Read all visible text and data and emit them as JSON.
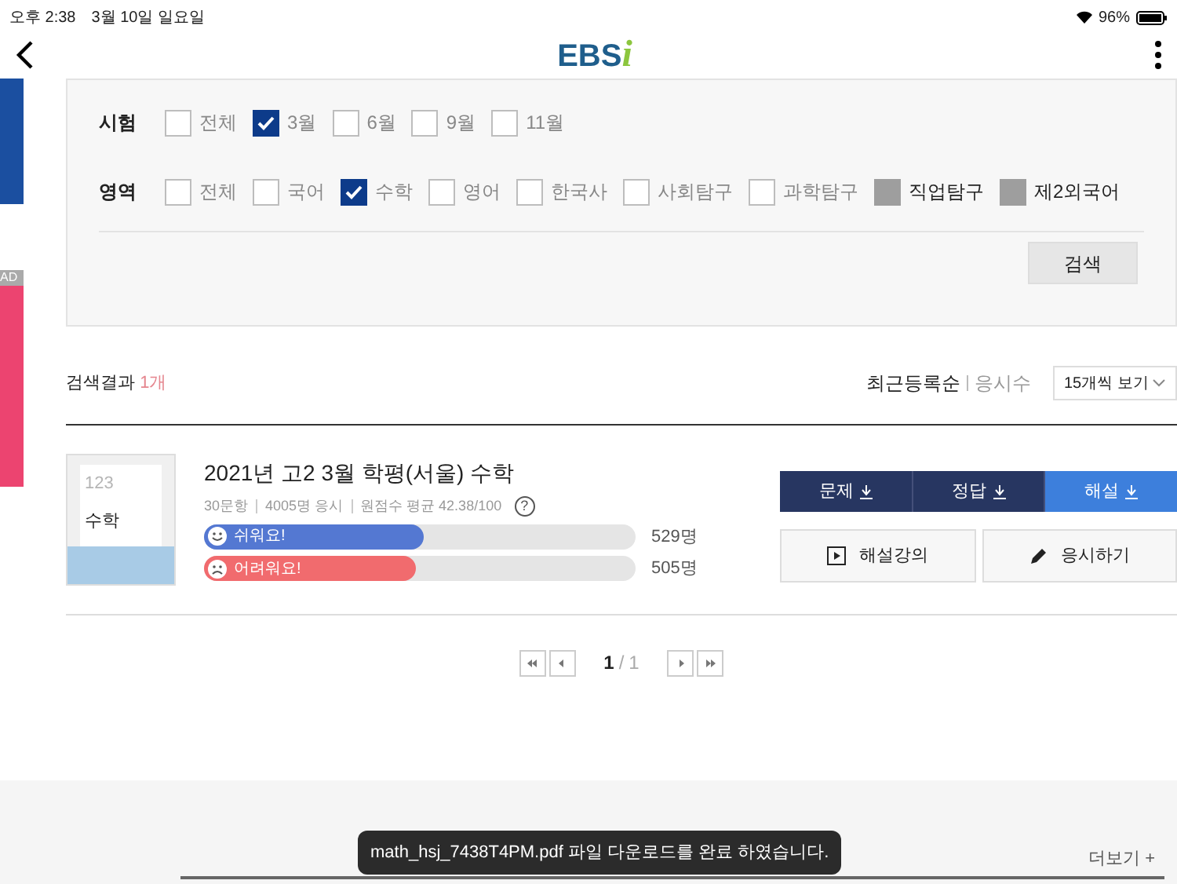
{
  "status_bar": {
    "time": "오후 2:38",
    "date": "3월 10일 일요일",
    "battery": "96%"
  },
  "header": {
    "logo_text": "EBS",
    "logo_accent": "i"
  },
  "side_ad": {
    "label": "AD"
  },
  "filters": [
    {
      "label": "시험",
      "options": [
        {
          "label": "전체",
          "checked": false,
          "disabled": false
        },
        {
          "label": "3월",
          "checked": true,
          "disabled": false
        },
        {
          "label": "6월",
          "checked": false,
          "disabled": false
        },
        {
          "label": "9월",
          "checked": false,
          "disabled": false
        },
        {
          "label": "11월",
          "checked": false,
          "disabled": false
        }
      ]
    },
    {
      "label": "영역",
      "options": [
        {
          "label": "전체",
          "checked": false,
          "disabled": false
        },
        {
          "label": "국어",
          "checked": false,
          "disabled": false
        },
        {
          "label": "수학",
          "checked": true,
          "disabled": false
        },
        {
          "label": "영어",
          "checked": false,
          "disabled": false
        },
        {
          "label": "한국사",
          "checked": false,
          "disabled": false
        },
        {
          "label": "사회탐구",
          "checked": false,
          "disabled": false
        },
        {
          "label": "과학탐구",
          "checked": false,
          "disabled": false
        },
        {
          "label": "직업탐구",
          "checked": false,
          "disabled": true
        },
        {
          "label": "제2외국어",
          "checked": false,
          "disabled": true
        }
      ]
    }
  ],
  "search_button": "검색",
  "results": {
    "label": "검색결과",
    "count": "1개",
    "sorts": [
      {
        "label": "최근등록순",
        "selected": true
      },
      {
        "label": "응시수",
        "selected": false
      }
    ],
    "page_size": "15개씩 보기"
  },
  "items": [
    {
      "thumb_number": "123",
      "thumb_subject": "수학",
      "title": "2021년 고2 3월 학평(서울) 수학",
      "meta": [
        "30문항",
        "4005명 응시",
        "원점수 평균 42.38/100"
      ],
      "help": "?",
      "votes": [
        {
          "kind": "easy",
          "label": "쉬워요!",
          "level": 0.51,
          "count": "529명"
        },
        {
          "kind": "hard",
          "label": "어려워요!",
          "level": 0.49,
          "count": "505명"
        }
      ],
      "downloads": [
        {
          "label": "문제",
          "selected": false
        },
        {
          "label": "정답",
          "selected": false
        },
        {
          "label": "해설",
          "selected": true
        }
      ],
      "actions": [
        {
          "kind": "lecture",
          "label": "해설강의"
        },
        {
          "kind": "exam",
          "label": "응시하기"
        }
      ]
    }
  ],
  "pagination": {
    "current": "1",
    "separator": "/",
    "total": "1"
  },
  "footer": {
    "more": "더보기 +"
  },
  "toast": "math_hsj_7438T4PM.pdf 파일 다운로드를 완료 하였습니다."
}
